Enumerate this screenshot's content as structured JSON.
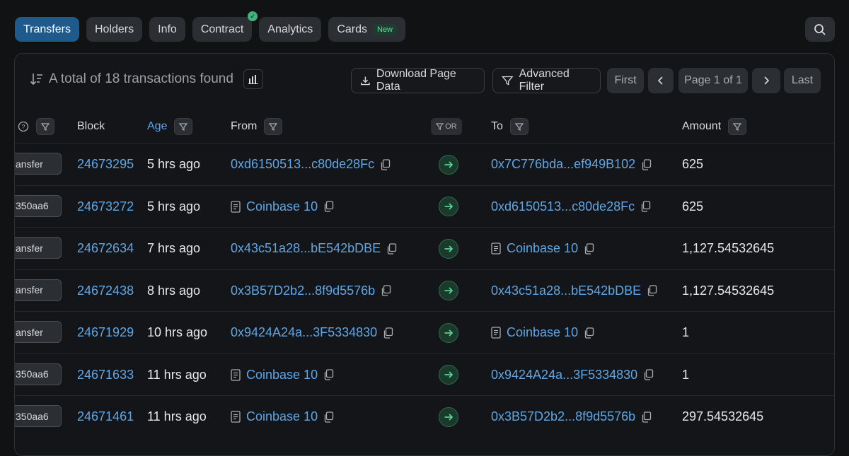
{
  "tabs": [
    {
      "label": "Transfers",
      "active": true
    },
    {
      "label": "Holders"
    },
    {
      "label": "Info"
    },
    {
      "label": "Contract",
      "verified": true
    },
    {
      "label": "Analytics"
    },
    {
      "label": "Cards",
      "badge": "New"
    }
  ],
  "summary": {
    "text": "A total of 18 transactions found"
  },
  "toolbar": {
    "download_label": "Download Page Data",
    "filter_label": "Advanced Filter"
  },
  "pagination": {
    "first": "First",
    "page": "Page 1 of 1",
    "last": "Last"
  },
  "columns": {
    "method": "",
    "block": "Block",
    "age": "Age",
    "from": "From",
    "or": "OR",
    "to": "To",
    "amount": "Amount"
  },
  "rows": [
    {
      "method": "ansfer",
      "block": "24673295",
      "age": "5 hrs ago",
      "from": "0xd6150513...c80de28Fc",
      "from_named": false,
      "to": "0x7C776bda...ef949B102",
      "to_named": false,
      "amount": "625"
    },
    {
      "method": "350aa6",
      "block": "24673272",
      "age": "5 hrs ago",
      "from": "Coinbase 10",
      "from_named": true,
      "to": "0xd6150513...c80de28Fc",
      "to_named": false,
      "amount": "625"
    },
    {
      "method": "ansfer",
      "block": "24672634",
      "age": "7 hrs ago",
      "from": "0x43c51a28...bE542bDBE",
      "from_named": false,
      "to": "Coinbase 10",
      "to_named": true,
      "amount": "1,127.54532645"
    },
    {
      "method": "ansfer",
      "block": "24672438",
      "age": "8 hrs ago",
      "from": "0x3B57D2b2...8f9d5576b",
      "from_named": false,
      "to": "0x43c51a28...bE542bDBE",
      "to_named": false,
      "amount": "1,127.54532645"
    },
    {
      "method": "ansfer",
      "block": "24671929",
      "age": "10 hrs ago",
      "from": "0x9424A24a...3F5334830",
      "from_named": false,
      "to": "Coinbase 10",
      "to_named": true,
      "amount": "1"
    },
    {
      "method": "350aa6",
      "block": "24671633",
      "age": "11 hrs ago",
      "from": "Coinbase 10",
      "from_named": true,
      "to": "0x9424A24a...3F5334830",
      "to_named": false,
      "amount": "1"
    },
    {
      "method": "350aa6",
      "block": "24671461",
      "age": "11 hrs ago",
      "from": "Coinbase 10",
      "from_named": true,
      "to": "0x3B57D2b2...8f9d5576b",
      "to_named": false,
      "amount": "297.54532645"
    }
  ],
  "colors": {
    "accent": "#1e5a8c",
    "link": "#5fa6e4",
    "background": "#111214",
    "success": "#3fb27f"
  }
}
